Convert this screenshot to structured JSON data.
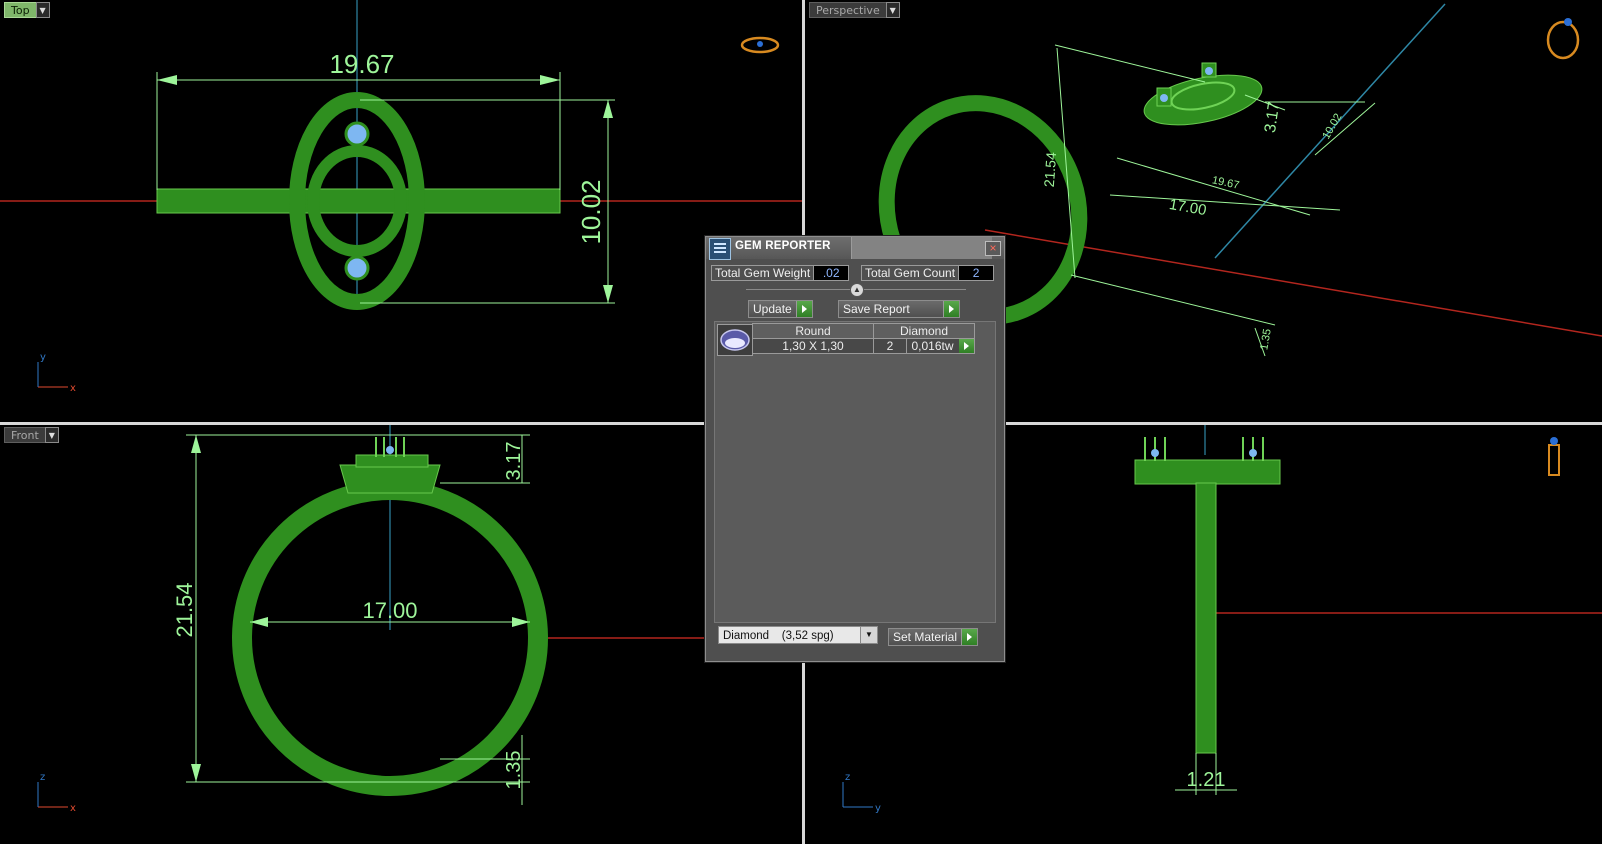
{
  "viewports": {
    "top": {
      "label": "Top",
      "dims": {
        "width": "19.67",
        "height": "10.02"
      },
      "axes": {
        "v": "y",
        "h": "x"
      }
    },
    "perspective": {
      "label": "Perspective",
      "dims": {
        "height": "21.54",
        "top": "3.17",
        "depth": "10.02",
        "width": "19.67",
        "inner": "17.00",
        "band": "1.35"
      }
    },
    "front": {
      "label": "Front",
      "dims": {
        "height": "21.54",
        "top": "3.17",
        "inner": "17.00",
        "band": "1.35"
      },
      "axes": {
        "v": "z",
        "h": "x"
      }
    },
    "right": {
      "dims": {
        "band": "1.21"
      },
      "axes": {
        "v": "z",
        "h": "y"
      }
    }
  },
  "gem_reporter": {
    "title": "GEM REPORTER",
    "total_weight_label": "Total Gem Weight",
    "total_weight_value": ".02",
    "total_count_label": "Total Gem Count",
    "total_count_value": "2",
    "update_label": "Update",
    "save_label": "Save Report",
    "table": {
      "headers": [
        "Round",
        "Diamond"
      ],
      "row": {
        "size": "1,30 X 1,30",
        "count": "2",
        "weight": "0,016tw"
      }
    },
    "material_select": "Diamond    (3,52 spg)",
    "set_material_label": "Set Material"
  },
  "colors": {
    "model": "#2f8f1f",
    "dim_line": "#9ef59a",
    "axis_red": "#b3261e",
    "axis_blue": "#2e87a5"
  }
}
